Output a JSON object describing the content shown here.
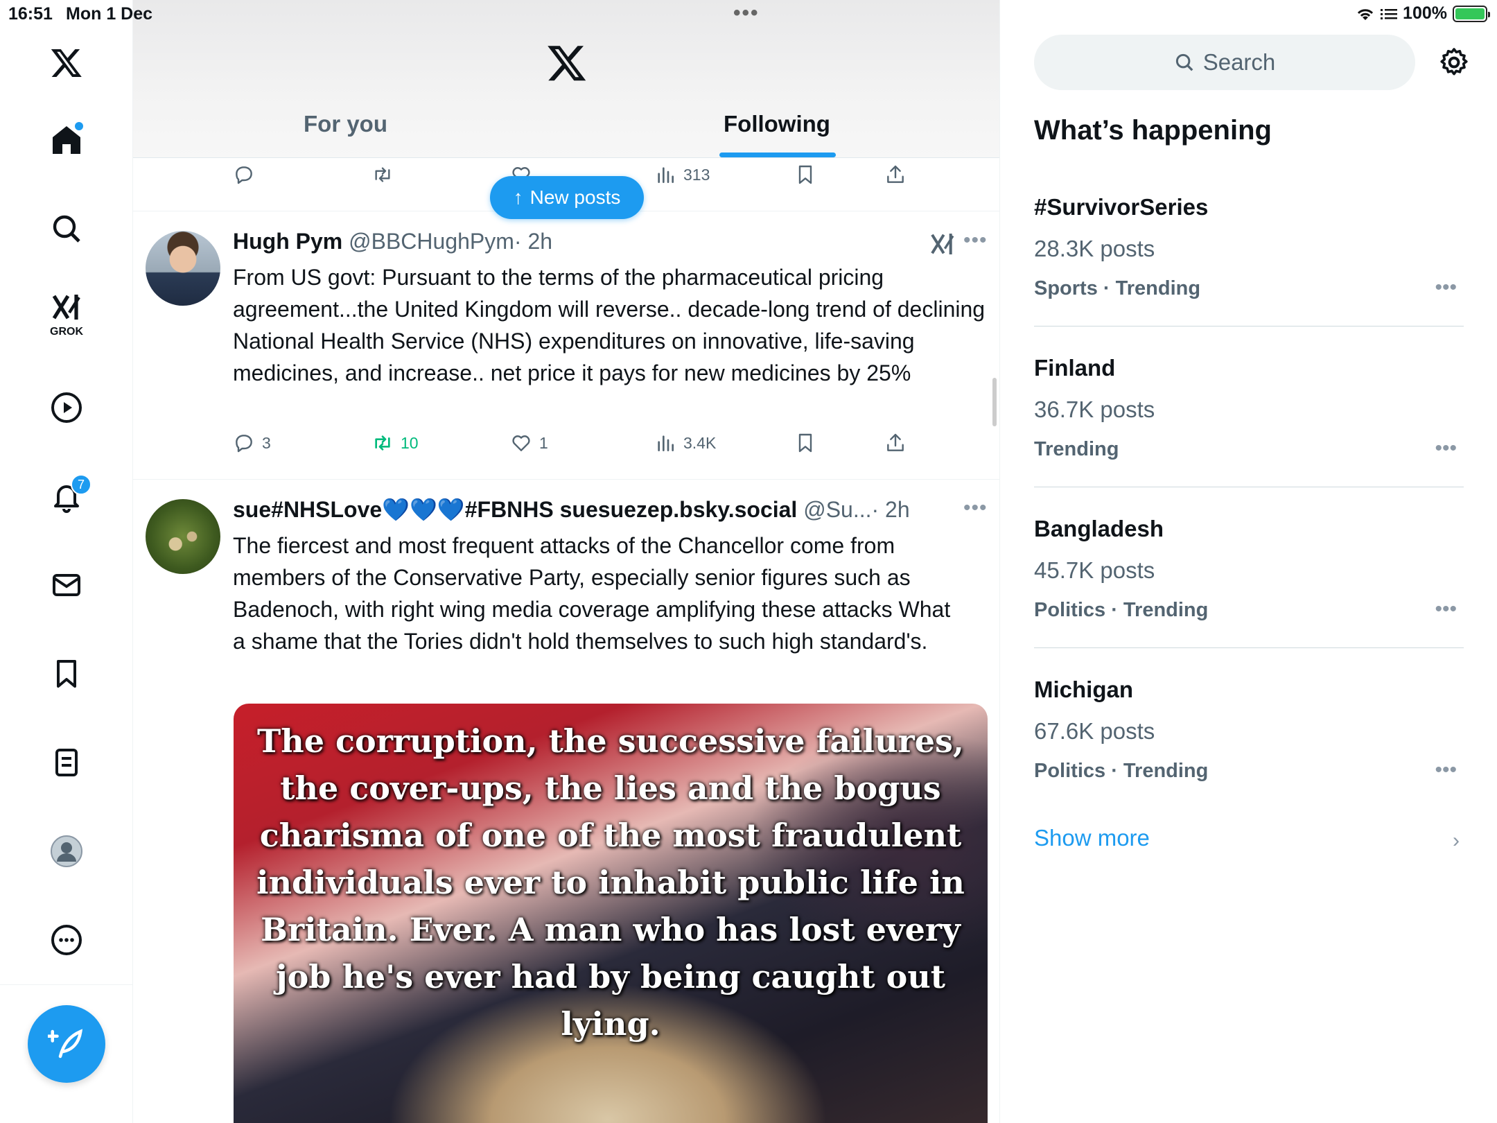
{
  "status_bar": {
    "time": "16:51",
    "date": "Mon 1 Dec",
    "battery": "100%"
  },
  "rail": {
    "grok_label": "GROK",
    "notifications_count": "7"
  },
  "header": {
    "tabs": [
      {
        "label": "For you"
      },
      {
        "label": "Following"
      }
    ]
  },
  "prev_post_actions": {
    "views": "313"
  },
  "new_posts_label": "New posts",
  "posts": [
    {
      "name": "Hugh Pym",
      "handle": "@BBCHughPym",
      "time": "· 2h",
      "text": "From US govt: Pursuant to the terms of the pharmaceutical pricing agreement...the United Kingdom will reverse.. decade-long trend of declining National Health Service (NHS) expenditures on innovative, life-saving medicines, and increase.. net price it pays for new medicines by 25%",
      "replies": "3",
      "reposts": "10",
      "likes": "1",
      "views": "3.4K"
    },
    {
      "name": "sue#NHSLove💙💙💙#FBNHS suesuezep.bsky.social",
      "handle": "@Su...",
      "time": "· 2h",
      "text": "The fiercest and most frequent attacks of the Chancellor come from members of the Conservative Party, especially senior figures such as Badenoch, with right wing media coverage amplifying these attacks What a shame that the Tories didn't hold themselves to such high standard's.",
      "image_text": "The corruption, the successive failures, the cover-ups, the lies and the bogus charisma of one of the most fraudulent individuals ever to inhabit public life in Britain. Ever. A man who has lost every job he's ever had by being caught out lying."
    }
  ],
  "sidebar": {
    "search_placeholder": "Search",
    "title": "What’s happening",
    "trends": [
      {
        "name": "#SurvivorSeries",
        "count": "28.3K posts",
        "meta": "Sports · Trending"
      },
      {
        "name": "Finland",
        "count": "36.7K posts",
        "meta": "Trending"
      },
      {
        "name": "Bangladesh",
        "count": "45.7K posts",
        "meta": "Politics · Trending"
      },
      {
        "name": "Michigan",
        "count": "67.6K posts",
        "meta": "Politics · Trending"
      }
    ],
    "show_more": "Show more"
  },
  "colors": {
    "accent": "#1d9bf0",
    "repost_green": "#00ba7c",
    "secondary_text": "#536471"
  }
}
